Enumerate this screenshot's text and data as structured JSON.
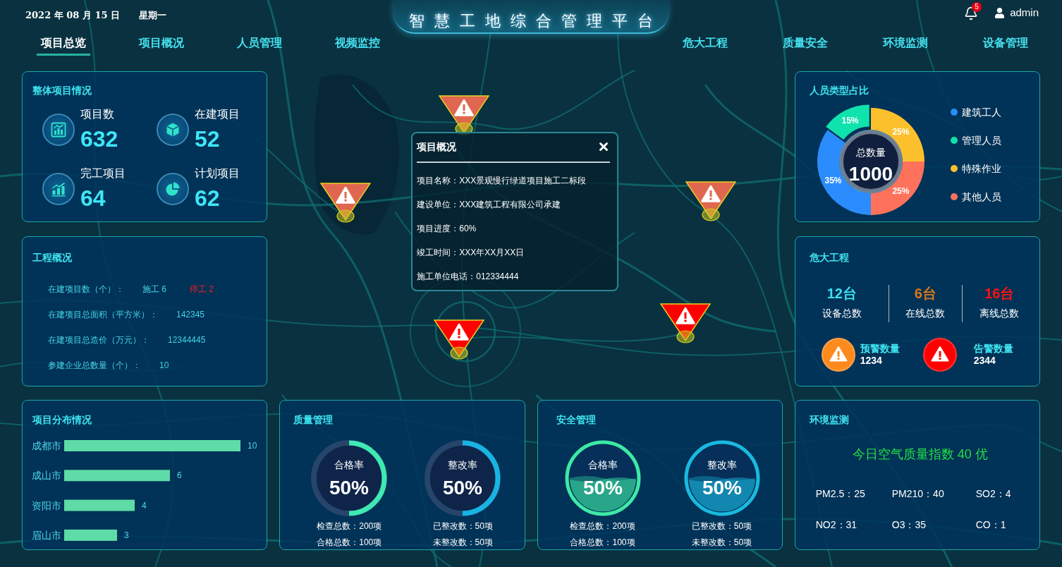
{
  "header": {
    "date": "2022 年 08 月 15 日",
    "weekday": "星期一",
    "title": "智慧工地综合管理平台",
    "notification_count": "5",
    "user": "admin"
  },
  "nav": {
    "left": [
      {
        "label": "项目总览",
        "selected": true
      },
      {
        "label": "项目概况",
        "selected": false
      },
      {
        "label": "人员管理",
        "selected": false
      },
      {
        "label": "视频监控",
        "selected": false
      }
    ],
    "right": [
      {
        "label": "危大工程",
        "selected": false
      },
      {
        "label": "质量安全",
        "selected": false
      },
      {
        "label": "环境监测",
        "selected": false
      },
      {
        "label": "设备管理",
        "selected": false
      }
    ]
  },
  "overview": {
    "title": "整体项目情况",
    "stats": [
      {
        "label": "项目数",
        "value": "632"
      },
      {
        "label": "在建项目",
        "value": "52"
      },
      {
        "label": "完工项目",
        "value": "64"
      },
      {
        "label": "计划项目",
        "value": "62"
      }
    ]
  },
  "map": {
    "markers": [
      {
        "color": "#e0674f"
      },
      {
        "color": "#e0674f"
      },
      {
        "color": "#e0674f"
      },
      {
        "color": "#ff0000"
      },
      {
        "color": "#ff0000"
      }
    ],
    "popup": {
      "title": "项目概况",
      "fields": [
        "项目名称：XXX景观慢行绿道项目施工二标段",
        "建设单位：XXX建筑工程有限公司承建",
        "项目进度：60%",
        "竣工时间：XXX年XX月XX日",
        "施工单位电话：012334444"
      ]
    }
  },
  "personnel": {
    "title": "人员类型占比",
    "chart_data": {
      "type": "donut",
      "categories": [
        "建筑工人",
        "管理人员",
        "特殊作业",
        "其他人员"
      ],
      "values": [
        35,
        15,
        25,
        25
      ],
      "value_labels": [
        "35%",
        "15%",
        "25%",
        "25%"
      ]
    },
    "slices": [
      {
        "color": "#2b8cfd",
        "selected": false
      },
      {
        "color": "#10e2ad",
        "selected": true
      },
      {
        "color": "#fbc02c",
        "selected": false
      },
      {
        "color": "#fe725c",
        "selected": false
      }
    ],
    "center_label": "总数量",
    "center_value": "1000"
  },
  "summary": {
    "title": "工程概况",
    "rows": [
      {
        "label": "在建项目数（个）：",
        "values": [
          {
            "text": "施工 6",
            "color": "#3fd3e3"
          },
          {
            "text": "停工 2",
            "color": "#ff1f1f"
          }
        ]
      },
      {
        "label": "在建项目总面积（平方米）：",
        "values": [
          {
            "text": "142345",
            "color": "#3fd3e3"
          }
        ]
      },
      {
        "label": "在建项目总造价（万元）：",
        "values": [
          {
            "text": "12344445",
            "color": "#3fd3e3"
          }
        ]
      },
      {
        "label": "参建企业总数量（个）：",
        "values": [
          {
            "text": "10",
            "color": "#3fd3e3"
          }
        ]
      }
    ]
  },
  "danger": {
    "title": "危大工程",
    "stats": [
      {
        "value": "12台",
        "label": "设备总数",
        "color": "#3fdfee"
      },
      {
        "value": "6台",
        "label": "在线总数",
        "color": "#d9771b"
      },
      {
        "value": "16台",
        "label": "离线总数",
        "color": "#ff1212"
      }
    ],
    "alerts": [
      {
        "label": "预警数量",
        "value": "1234",
        "color": "#fd8a1c"
      },
      {
        "label": "告警数量",
        "value": "2344",
        "color": "#ff0000"
      }
    ]
  },
  "distribution": {
    "title": "项目分布情况",
    "chart_data": {
      "type": "bar",
      "orientation": "horizontal",
      "categories": [
        "成都市",
        "成山市",
        "资阳市",
        "眉山市"
      ],
      "values": [
        10,
        6,
        4,
        3
      ],
      "data_labels": true
    }
  },
  "quality": {
    "title": "质量管理",
    "gauges": [
      {
        "kind": "ring",
        "label": "合格率",
        "level": 0.5,
        "reading": "50%",
        "color": "#3ee9b2",
        "lines": [
          "检查总数：200项",
          "合格总数：100项"
        ]
      },
      {
        "kind": "ring",
        "label": "整改率",
        "level": 0.5,
        "reading": "50%",
        "color": "#17b3e3",
        "lines": [
          "已整改数：50项",
          "未整改数：50项"
        ]
      }
    ]
  },
  "safety": {
    "title": "安全管理",
    "gauges": [
      {
        "kind": "wave",
        "label": "合格率",
        "level": 0.5,
        "reading": "50%",
        "color": "#3de9a6",
        "lines": [
          "检查总数：200项",
          "合格总数：100项"
        ]
      },
      {
        "kind": "wave",
        "label": "整改率",
        "level": 0.5,
        "reading": "50%",
        "color": "#1ab9df",
        "lines": [
          "已整改数：50项",
          "未整改数：50项"
        ]
      }
    ]
  },
  "environment": {
    "title": "环境监测",
    "headline": "今日空气质量指数 40 优",
    "readings": [
      "PM2.5：25",
      "PM210：40",
      "SO2：4",
      "NO2：31",
      "O3：35",
      "CO：1"
    ]
  }
}
